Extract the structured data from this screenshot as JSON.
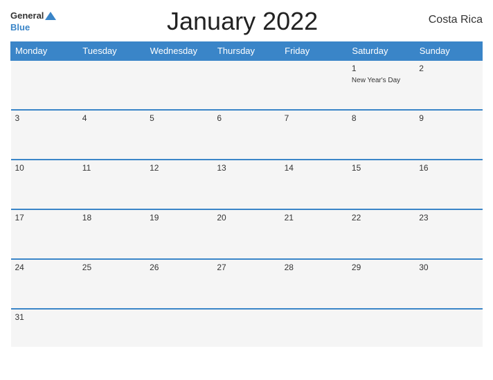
{
  "header": {
    "logo_general": "General",
    "logo_blue": "Blue",
    "title": "January 2022",
    "country": "Costa Rica"
  },
  "columns": [
    "Monday",
    "Tuesday",
    "Wednesday",
    "Thursday",
    "Friday",
    "Saturday",
    "Sunday"
  ],
  "weeks": [
    [
      {
        "day": "",
        "holiday": ""
      },
      {
        "day": "",
        "holiday": ""
      },
      {
        "day": "",
        "holiday": ""
      },
      {
        "day": "",
        "holiday": ""
      },
      {
        "day": "",
        "holiday": ""
      },
      {
        "day": "1",
        "holiday": "New Year's Day"
      },
      {
        "day": "2",
        "holiday": ""
      }
    ],
    [
      {
        "day": "3",
        "holiday": ""
      },
      {
        "day": "4",
        "holiday": ""
      },
      {
        "day": "5",
        "holiday": ""
      },
      {
        "day": "6",
        "holiday": ""
      },
      {
        "day": "7",
        "holiday": ""
      },
      {
        "day": "8",
        "holiday": ""
      },
      {
        "day": "9",
        "holiday": ""
      }
    ],
    [
      {
        "day": "10",
        "holiday": ""
      },
      {
        "day": "11",
        "holiday": ""
      },
      {
        "day": "12",
        "holiday": ""
      },
      {
        "day": "13",
        "holiday": ""
      },
      {
        "day": "14",
        "holiday": ""
      },
      {
        "day": "15",
        "holiday": ""
      },
      {
        "day": "16",
        "holiday": ""
      }
    ],
    [
      {
        "day": "17",
        "holiday": ""
      },
      {
        "day": "18",
        "holiday": ""
      },
      {
        "day": "19",
        "holiday": ""
      },
      {
        "day": "20",
        "holiday": ""
      },
      {
        "day": "21",
        "holiday": ""
      },
      {
        "day": "22",
        "holiday": ""
      },
      {
        "day": "23",
        "holiday": ""
      }
    ],
    [
      {
        "day": "24",
        "holiday": ""
      },
      {
        "day": "25",
        "holiday": ""
      },
      {
        "day": "26",
        "holiday": ""
      },
      {
        "day": "27",
        "holiday": ""
      },
      {
        "day": "28",
        "holiday": ""
      },
      {
        "day": "29",
        "holiday": ""
      },
      {
        "day": "30",
        "holiday": ""
      }
    ],
    [
      {
        "day": "31",
        "holiday": ""
      },
      {
        "day": "",
        "holiday": ""
      },
      {
        "day": "",
        "holiday": ""
      },
      {
        "day": "",
        "holiday": ""
      },
      {
        "day": "",
        "holiday": ""
      },
      {
        "day": "",
        "holiday": ""
      },
      {
        "day": "",
        "holiday": ""
      }
    ]
  ]
}
